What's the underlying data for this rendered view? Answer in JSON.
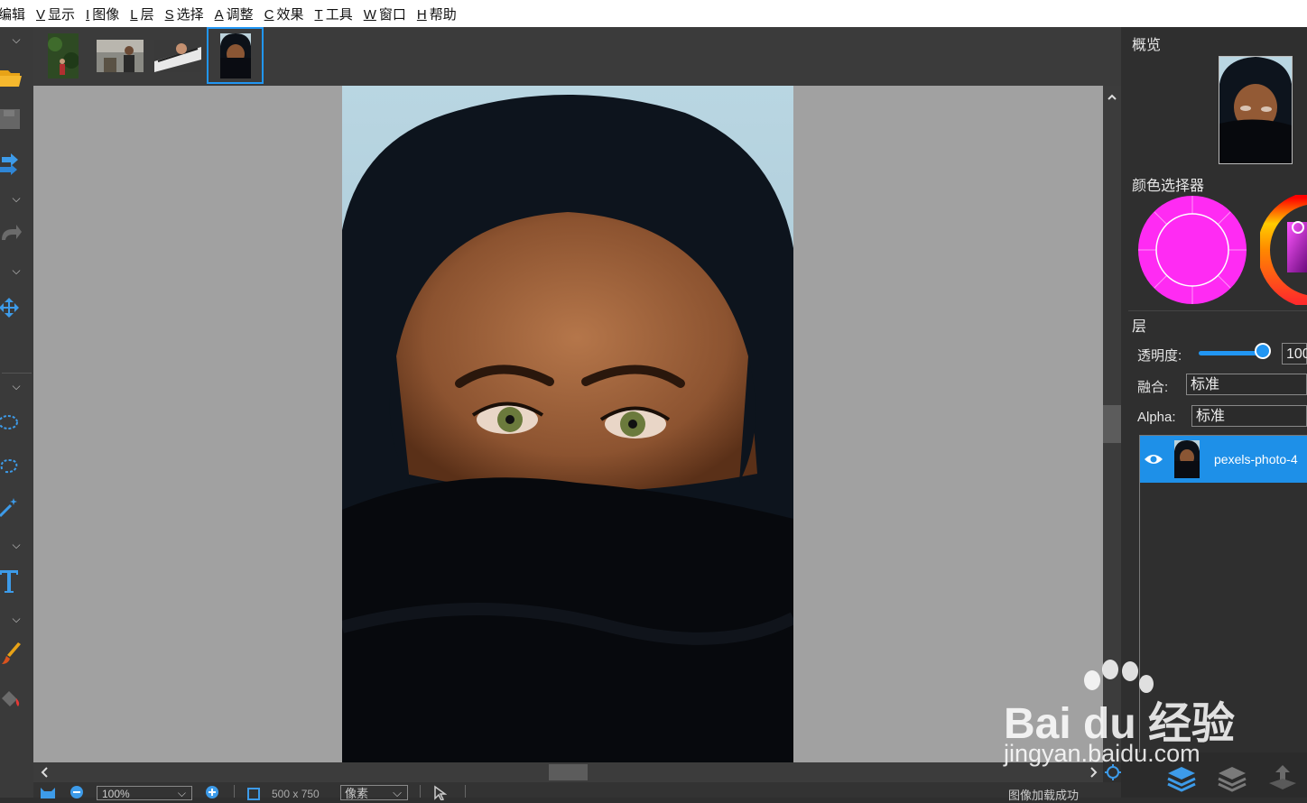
{
  "menu": [
    {
      "key": "",
      "label": "编辑"
    },
    {
      "key": "V",
      "label": "显示"
    },
    {
      "key": "I",
      "label": "图像"
    },
    {
      "key": "L",
      "label": "层"
    },
    {
      "key": "S",
      "label": "选择"
    },
    {
      "key": "A",
      "label": "调整"
    },
    {
      "key": "C",
      "label": "效果"
    },
    {
      "key": "T",
      "label": "工具"
    },
    {
      "key": "W",
      "label": "窗口"
    },
    {
      "key": "H",
      "label": "帮助"
    }
  ],
  "tool_icons": [
    "folder-open-icon",
    "save-icon",
    "swap-icon",
    "redo-icon",
    "move-icon",
    "ellipse-select-icon",
    "lasso-icon",
    "magic-wand-icon",
    "text-icon",
    "brush-icon",
    "paint-bucket-icon"
  ],
  "status": {
    "zoom": "100%",
    "size": "500 x 750",
    "unit": "像素",
    "message": "图像加载成功"
  },
  "panel": {
    "overview_title": "概览",
    "color_picker_title": "颜色选择器",
    "layers_title": "层",
    "opacity_label": "透明度:",
    "opacity_value": "100",
    "opacity_level": 1.0,
    "blend_label": "融合:",
    "blend_value": "标准",
    "alpha_label": "Alpha:",
    "alpha_value": "标准",
    "layer_name": "pexels-photo-4"
  },
  "colors": {
    "primary": "#ff2bf3",
    "accent": "#2196f3",
    "selection": "#1e90e8"
  },
  "watermark": {
    "brand": "Bai du 经验",
    "url": "jingyan.baidu.com"
  }
}
